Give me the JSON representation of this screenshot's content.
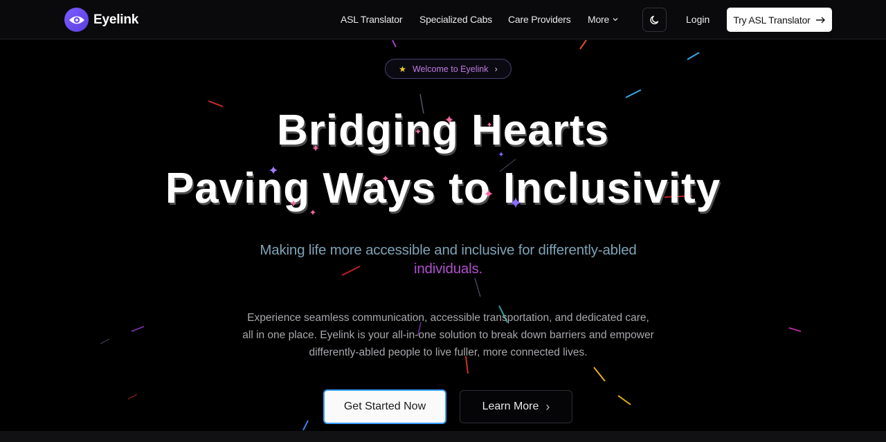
{
  "header": {
    "brand": "Eyelink",
    "nav": [
      {
        "label": "ASL Translator"
      },
      {
        "label": "Specialized Cabs"
      },
      {
        "label": "Care Providers"
      },
      {
        "label": "More"
      }
    ],
    "login_label": "Login",
    "cta_label": "Try ASL Translator",
    "icons": {
      "logo": "eye-icon",
      "theme": "moon-icon",
      "more": "chevron-down-icon",
      "cta": "arrow-right-icon"
    }
  },
  "hero": {
    "badge_label": "Welcome to Eyelink",
    "title_line1": "Bridging Hearts",
    "title_line2": "Paving Ways to Inclusivity",
    "subtitle_part1": "Making life more accessible and inclusive for differently-abled",
    "subtitle_part2": "individuals.",
    "description": "Experience seamless communication, accessible transportation, and dedicated care, all in one place. Eyelink is your all-in-one solution to break down barriers and empower differently-abled people to live fuller, more connected lives.",
    "primary_button": "Get Started Now",
    "secondary_button": "Learn More"
  },
  "colors": {
    "background": "#000000",
    "accent_purple": "#7c5cff",
    "subtitle_teal": "#7fa2b4",
    "subtitle_magenta": "#b150cf",
    "primary_button_border": "#3aa0ff"
  }
}
